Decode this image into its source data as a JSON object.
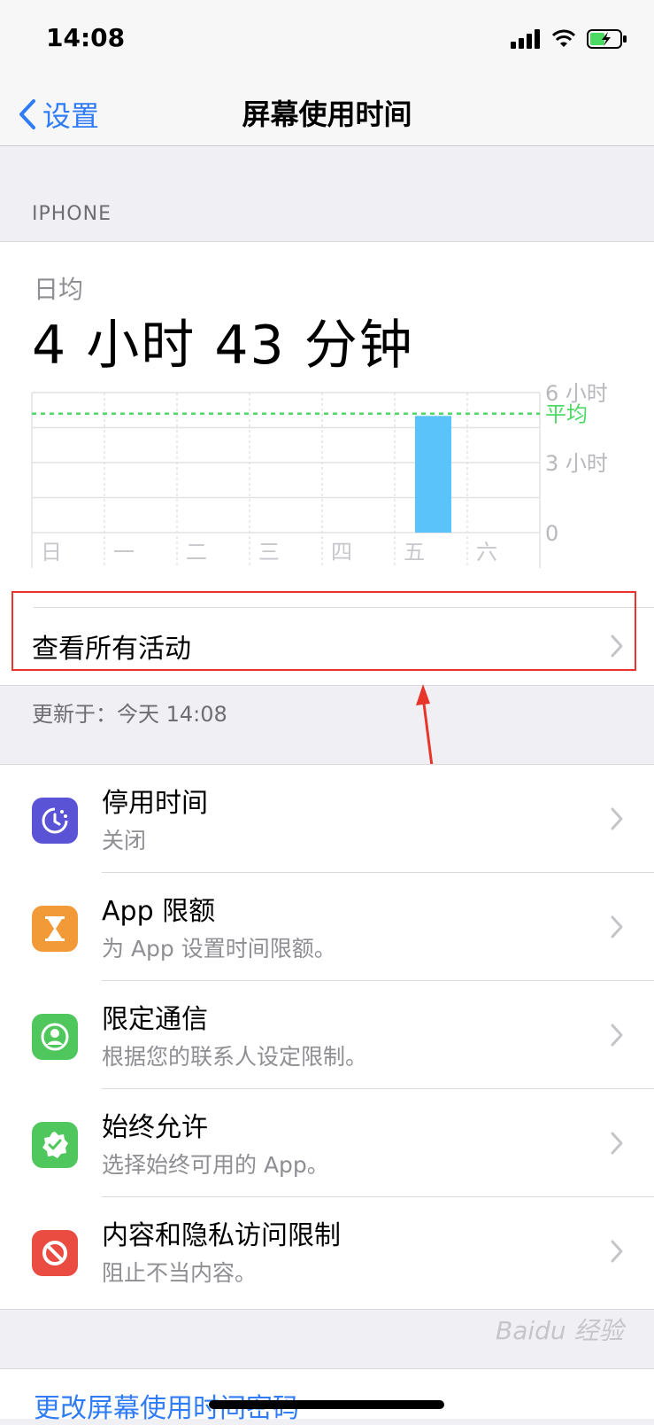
{
  "status_bar": {
    "time": "14:08"
  },
  "nav": {
    "back_label": "设置",
    "title": "屏幕使用时间"
  },
  "section_header": "IPHONE",
  "summary": {
    "daily_label": "日均",
    "daily_value": "4 小时 43 分钟",
    "see_all_label": "查看所有活动",
    "updated_text": "更新于：今天 14:08"
  },
  "chart_data": {
    "type": "bar",
    "categories": [
      "日",
      "一",
      "二",
      "三",
      "四",
      "五",
      "六"
    ],
    "values": [
      0,
      0,
      0,
      0,
      0,
      5,
      0
    ],
    "unit": "小时",
    "ylim": [
      0,
      6
    ],
    "y_ticks": [
      "6 小时",
      "3 小时",
      "0"
    ],
    "average_label": "平均",
    "average_value": 5.1,
    "bar_color": "#5ac3fa",
    "average_color": "#4cd964"
  },
  "settings": [
    {
      "title": "停用时间",
      "subtitle": "关闭",
      "icon": "downtime-icon",
      "color": "#5b53d6"
    },
    {
      "title": "App 限额",
      "subtitle": "为 App 设置时间限额。",
      "icon": "hourglass-icon",
      "color": "#f29a38"
    },
    {
      "title": "限定通信",
      "subtitle": "根据您的联系人设定限制。",
      "icon": "contact-icon",
      "color": "#4fc75c"
    },
    {
      "title": "始终允许",
      "subtitle": "选择始终可用的 App。",
      "icon": "checkmark-badge-icon",
      "color": "#4fc75c"
    },
    {
      "title": "内容和隐私访问限制",
      "subtitle": "阻止不当内容。",
      "icon": "restriction-icon",
      "color": "#eb4c42"
    }
  ],
  "passcode_link": "更改屏幕使用时间密码",
  "watermark": "Baidu 经验"
}
